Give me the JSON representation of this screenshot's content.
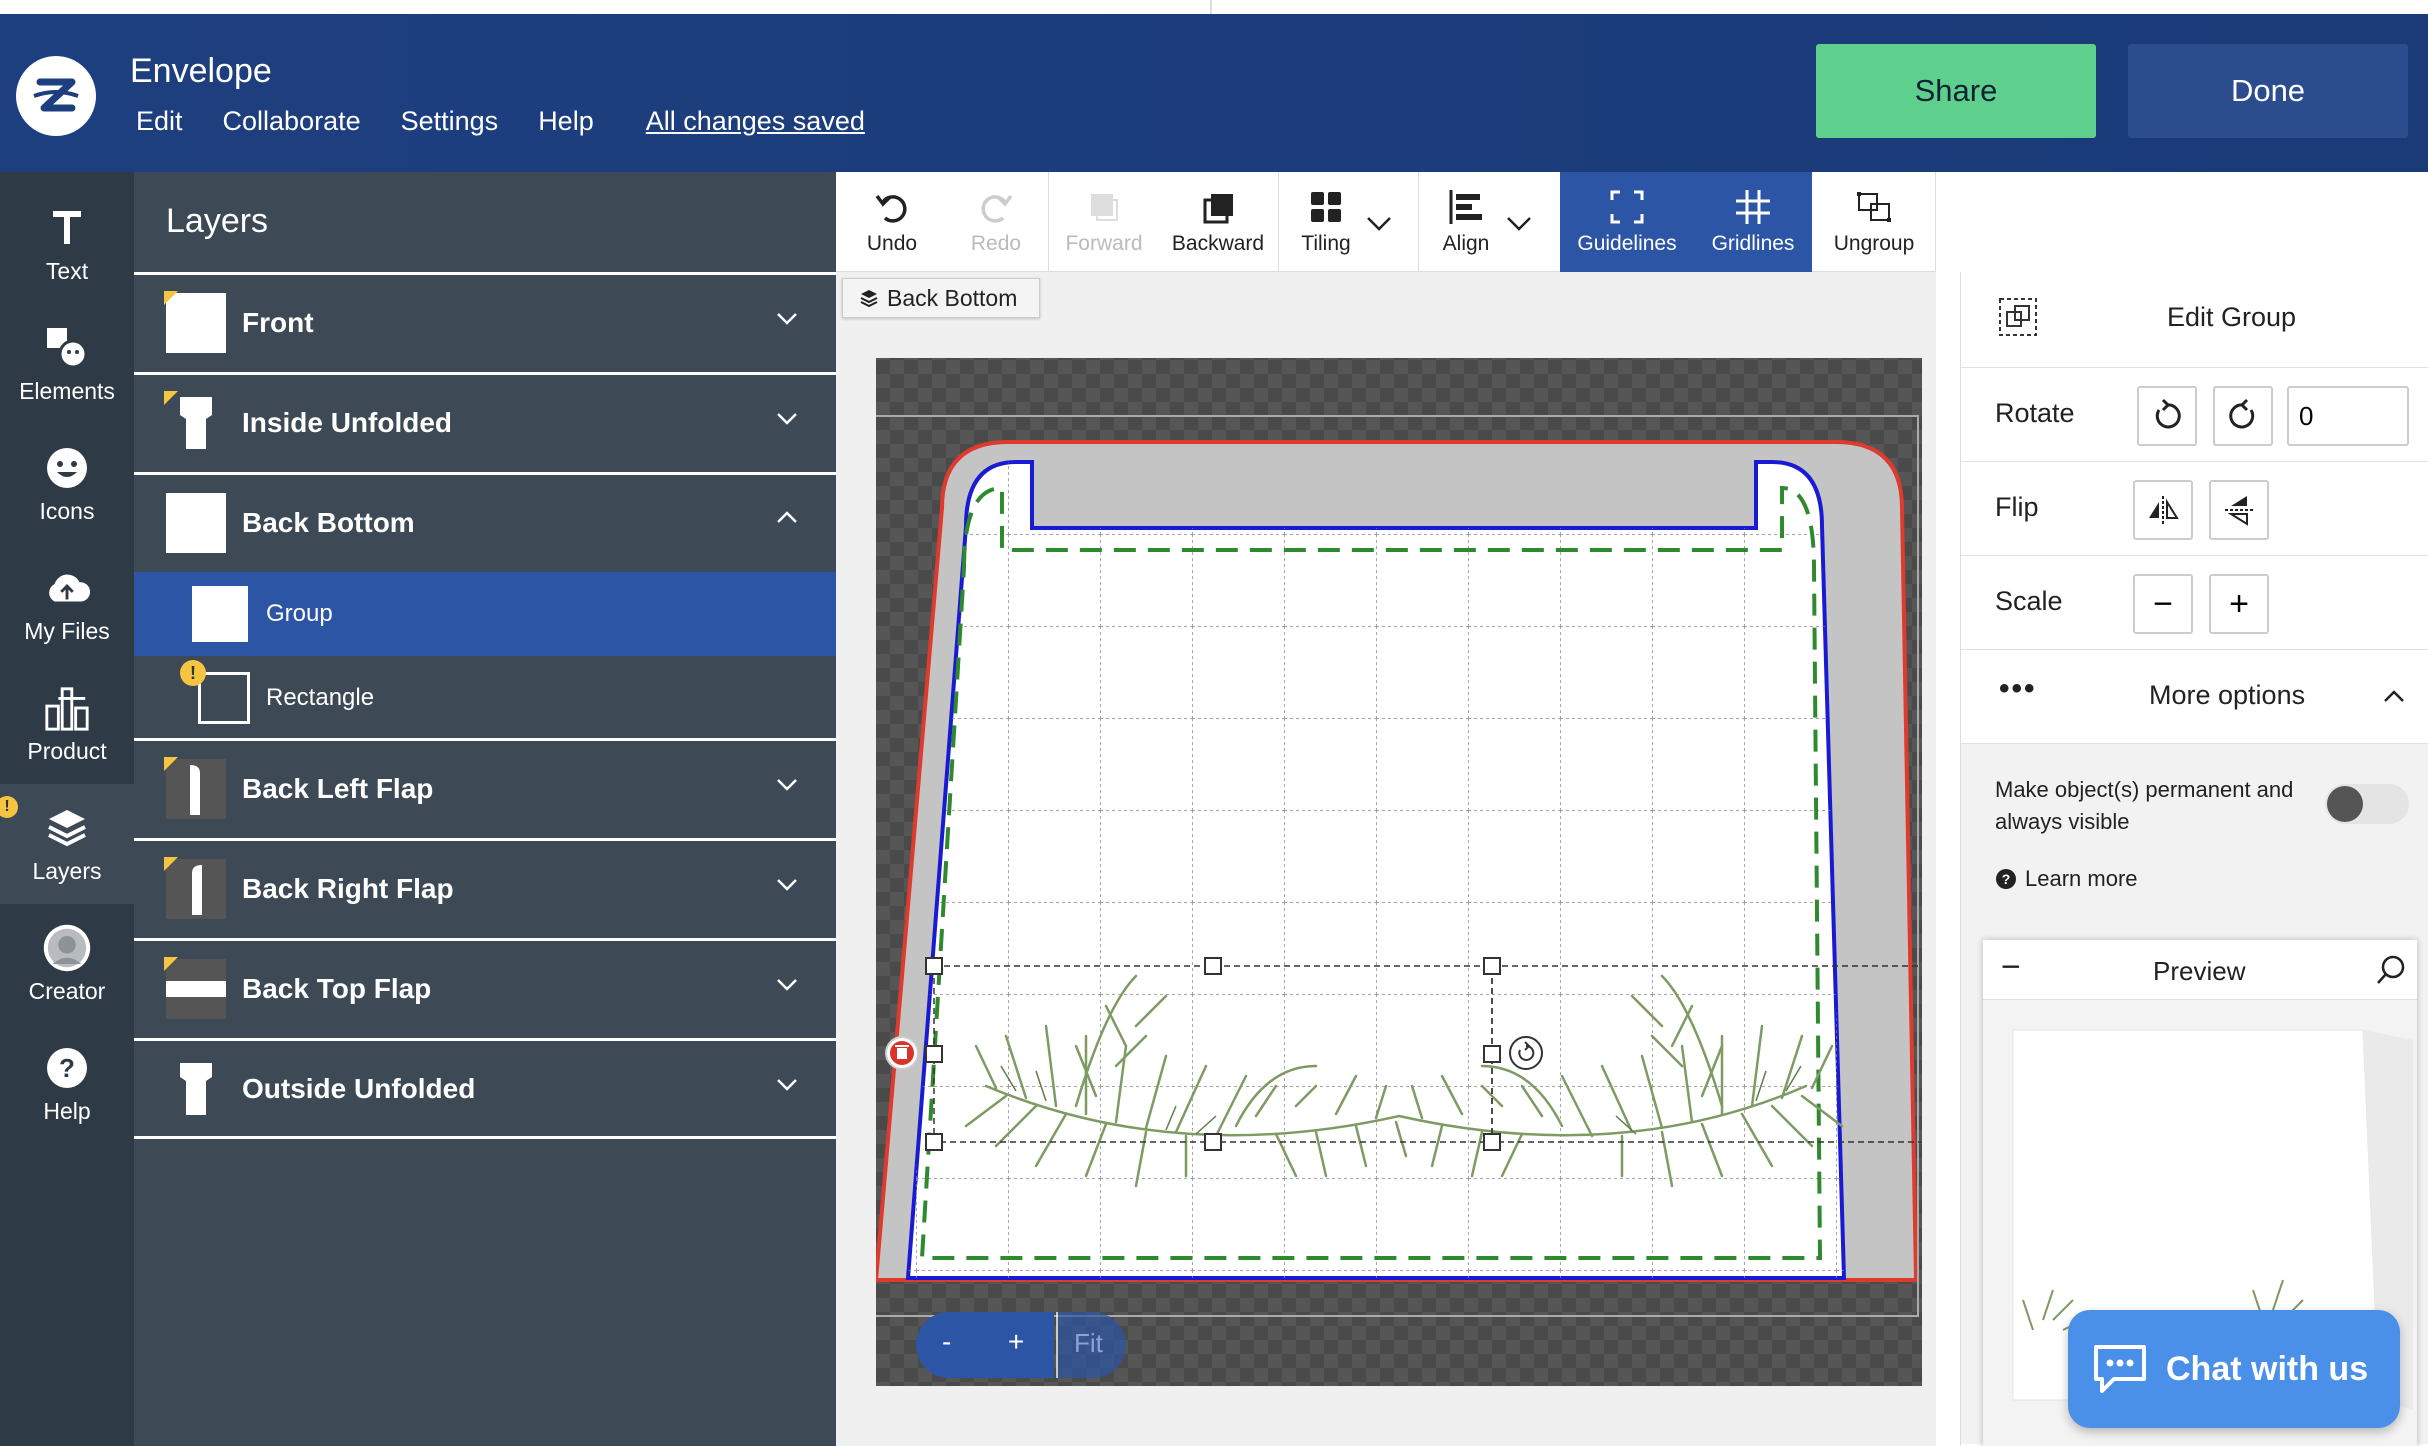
{
  "app": {
    "doc_title": "Envelope",
    "menu": [
      "Edit",
      "Collaborate",
      "Settings",
      "Help"
    ],
    "save_status": "All changes saved",
    "share_label": "Share",
    "done_label": "Done"
  },
  "rail": {
    "items": [
      {
        "label": "Text",
        "icon": "text-icon"
      },
      {
        "label": "Elements",
        "icon": "elements-icon"
      },
      {
        "label": "Icons",
        "icon": "smiley-icon"
      },
      {
        "label": "My Files",
        "icon": "cloud-upload-icon"
      },
      {
        "label": "Product",
        "icon": "product-icon"
      },
      {
        "label": "Layers",
        "icon": "layers-icon"
      },
      {
        "label": "Creator",
        "icon": "avatar-icon"
      },
      {
        "label": "Help",
        "icon": "help-icon"
      }
    ],
    "active": "Layers",
    "warn_glyph": "!"
  },
  "layers": {
    "title": "Layers",
    "rows": [
      {
        "name": "Front"
      },
      {
        "name": "Inside Unfolded"
      },
      {
        "name": "Back Bottom",
        "expanded": true
      },
      {
        "name": "Back Left Flap"
      },
      {
        "name": "Back Right Flap"
      },
      {
        "name": "Back Top Flap"
      },
      {
        "name": "Outside Unfolded"
      }
    ],
    "sub_rows": [
      {
        "name": "Group",
        "selected": true
      },
      {
        "name": "Rectangle"
      }
    ],
    "warn_glyph": "!"
  },
  "toolbar": {
    "undo": "Undo",
    "redo": "Redo",
    "forward": "Forward",
    "backward": "Backward",
    "tiling": "Tiling",
    "align": "Align",
    "guidelines": "Guidelines",
    "gridlines": "Gridlines",
    "ungroup": "Ungroup"
  },
  "canvas": {
    "layer_label": "Back Bottom",
    "zoom_out": "-",
    "zoom_in": "+",
    "fit": "Fit",
    "warn_glyph": "!"
  },
  "right_panel": {
    "title": "Edit Group",
    "rotate_label": "Rotate",
    "rotate_value": "0",
    "flip_label": "Flip",
    "scale_label": "Scale",
    "scale_minus": "−",
    "scale_plus": "+",
    "more_options_label": "More options",
    "permanent_text": "Make object(s) permanent and always visible",
    "permanent_on": false,
    "learn_more": "Learn more",
    "preview_label": "Preview",
    "preview_minus": "−"
  },
  "chat": {
    "label": "Chat with us"
  },
  "colors": {
    "header_bg": "#1e3f7f",
    "share_bg": "#5fcf8e",
    "done_bg": "#2b4d8e",
    "rail_bg": "#2e3a45",
    "panel_bg": "#3d4a56",
    "selected": "#2d55a6",
    "warn": "#f5c542",
    "bleed_red": "#e03a2f",
    "trim_blue": "#1a1ad4",
    "safe_green": "#2f8a2f",
    "chat_bg": "#4a8fe8"
  }
}
